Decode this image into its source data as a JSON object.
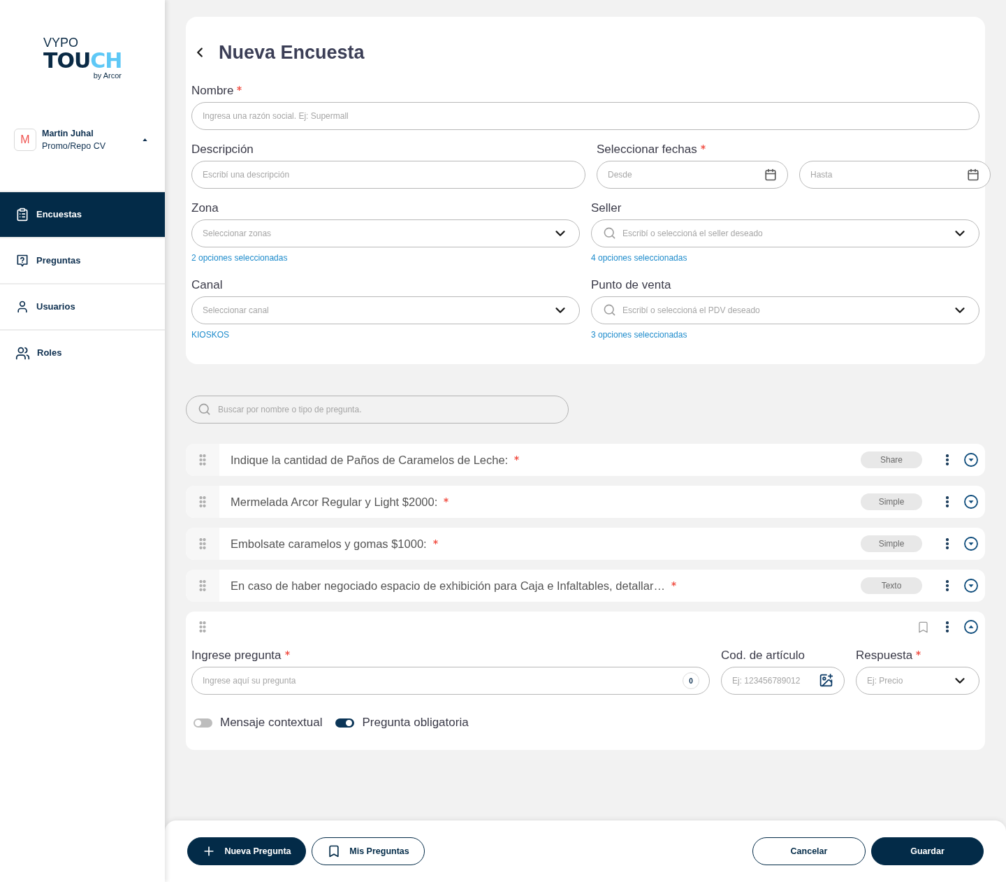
{
  "sidebar": {
    "logo": {
      "title": "VYPO",
      "wordmark": [
        {
          "text": "TOU",
          "color": "#0a2a45"
        },
        {
          "text": "CH",
          "color": "#5ec8f6"
        }
      ],
      "tagline": "by Arcor"
    },
    "user": {
      "initial": "M",
      "name": "Martin Juhal",
      "role": "Promo/Repo CV"
    },
    "nav": [
      {
        "label": "Encuestas",
        "selected": true
      },
      {
        "label": "Preguntas",
        "selected": false
      },
      {
        "label": "Usuarios",
        "selected": false
      },
      {
        "label": "Roles",
        "selected": false
      }
    ]
  },
  "survey_form": {
    "title": "Nueva Encuesta",
    "name": {
      "label": "Nombre",
      "required": true,
      "placeholder": "Ingresa una razón social. Ej: Supermall"
    },
    "description": {
      "label": "Descripción",
      "required": false,
      "placeholder": "Escribí una descripción"
    },
    "dates": {
      "label": "Seleccionar fechas",
      "required": true,
      "from_placeholder": "Desde",
      "to_placeholder": "Hasta"
    },
    "filters": [
      {
        "label": "Zona",
        "required": false,
        "kind": "select",
        "placeholder": "Seleccionar zonas",
        "selection": "2 opciones seleccionadas"
      },
      {
        "label": "Seller",
        "required": false,
        "kind": "search",
        "placeholder": "Escribí o seleccioná el seller deseado",
        "selection": "4 opciones seleccionadas"
      },
      {
        "label": "Canal",
        "required": false,
        "kind": "select",
        "placeholder": "Seleccionar canal",
        "selection": "KIOSKOS"
      },
      {
        "label": "Punto de venta",
        "required": false,
        "kind": "search",
        "placeholder": "Escribí o seleccioná el PDV deseado",
        "selection": "3 opciones seleccionadas"
      }
    ]
  },
  "question_search": {
    "placeholder": "Buscar por nombre o tipo de pregunta."
  },
  "questions": [
    {
      "text": "Indique la cantidad de Paños de Caramelos de Leche:",
      "required": true,
      "type": "Share",
      "expanded": false
    },
    {
      "text": "Mermelada Arcor Regular y Light $2000:",
      "required": true,
      "type": "Simple",
      "expanded": false
    },
    {
      "text": "Embolsate caramelos y gomas $1000:",
      "required": true,
      "type": "Simple",
      "expanded": false
    },
    {
      "text": "En caso de haber negociado espacio de exhibición para Caja e Infaltables, detallar…",
      "required": true,
      "type": "Texto",
      "expanded": false
    }
  ],
  "question_editor": {
    "expanded": true,
    "question": {
      "label": "Ingrese pregunta",
      "required": true,
      "placeholder": "Ingrese aquí su pregunta",
      "counter": "0"
    },
    "article_code": {
      "label": "Cod. de artículo",
      "required": false,
      "placeholder": "Ej: 123456789012"
    },
    "answer": {
      "label": "Respuesta",
      "required": true,
      "placeholder": "Ej: Precio"
    },
    "toggles": [
      {
        "label": "Mensaje contextual",
        "on": false
      },
      {
        "label": "Pregunta obligatoria",
        "on": true
      }
    ]
  },
  "footer": {
    "left_buttons": [
      {
        "label": "Nueva Pregunta",
        "kind": "primary"
      },
      {
        "label": "Mis Preguntas",
        "kind": "outline"
      }
    ],
    "right_buttons": [
      {
        "label": "Cancelar",
        "kind": "outline"
      },
      {
        "label": "Guardar",
        "kind": "primary"
      }
    ]
  }
}
